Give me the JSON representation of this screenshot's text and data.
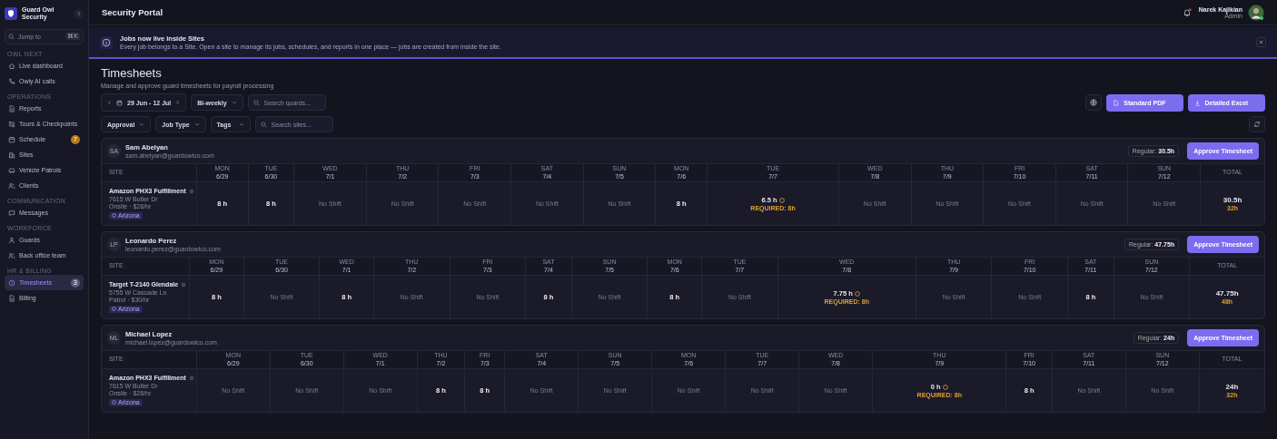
{
  "brand": {
    "name": "Guard Owl Security"
  },
  "sidebar": {
    "search": {
      "placeholder": "Jump to",
      "shortcut": "⌘K"
    },
    "sections": [
      {
        "title": "OWL NEXT",
        "items": [
          {
            "label": "Live dashboard",
            "selected": false
          },
          {
            "label": "Owly AI calls",
            "selected": false
          }
        ]
      },
      {
        "title": "OPERATIONS",
        "items": [
          {
            "label": "Reports",
            "selected": false
          },
          {
            "label": "Tours & Checkpoints",
            "selected": false
          },
          {
            "label": "Schedule",
            "selected": false,
            "badge": {
              "text": "7",
              "color": "#b7791f"
            }
          },
          {
            "label": "Sites",
            "selected": false
          },
          {
            "label": "Vehicle Patrols",
            "selected": false
          },
          {
            "label": "Clients",
            "selected": false
          }
        ]
      },
      {
        "title": "COMMUNICATION",
        "items": [
          {
            "label": "Messages",
            "selected": false
          }
        ]
      },
      {
        "title": "WORKFORCE",
        "items": [
          {
            "label": "Guards",
            "selected": false
          },
          {
            "label": "Back office team",
            "selected": false
          }
        ]
      },
      {
        "title": "HR & BILLING",
        "items": [
          {
            "label": "Timesheets",
            "selected": true,
            "badge": {
              "text": "3",
              "color": "#5a5a78"
            }
          },
          {
            "label": "Billing",
            "selected": false
          }
        ]
      }
    ]
  },
  "header": {
    "title": "Security Portal",
    "user": {
      "name": "Narek Kajikian",
      "role": "Admin"
    },
    "notifications_unread": true
  },
  "banner": {
    "title": "Jobs now live inside Sites",
    "text": "Every job belongs to a Site. Open a site to manage its jobs, schedules, and reports in one place — jobs are created from inside the site."
  },
  "page": {
    "title": "Timesheets",
    "subtitle": "Manage and approve guard timesheets for payroll processing"
  },
  "toolbar": {
    "date_range": "29 Jun - 12 Jul",
    "period": "Bi-weekly",
    "guard_search": {
      "placeholder": "Search guards..."
    },
    "export_buttons": [
      "Standard PDF",
      "Detailed Excel"
    ]
  },
  "filters": {
    "dropdowns": [
      "Approval",
      "Job Type",
      "Tags"
    ],
    "site_search": {
      "placeholder": "Search sites..."
    }
  },
  "timesheets": [
    {
      "site_column": "SITE",
      "total_column": "TOTAL",
      "initials": "SA",
      "name": "Sam Abelyan",
      "email": "sam.abelyan@guardowlco.com",
      "regular_label": "Regular:",
      "regular": "30.5h",
      "approve": "Approve Timesheet",
      "days": [
        {
          "day": "MON",
          "date": "6/29"
        },
        {
          "day": "TUE",
          "date": "6/30"
        },
        {
          "day": "WED",
          "date": "7/1"
        },
        {
          "day": "THU",
          "date": "7/2"
        },
        {
          "day": "FRI",
          "date": "7/3"
        },
        {
          "day": "SAT",
          "date": "7/4"
        },
        {
          "day": "SUN",
          "date": "7/5"
        },
        {
          "day": "MON",
          "date": "7/6"
        },
        {
          "day": "TUE",
          "date": "7/7"
        },
        {
          "day": "WED",
          "date": "7/8"
        },
        {
          "day": "THU",
          "date": "7/9"
        },
        {
          "day": "FRI",
          "date": "7/10"
        },
        {
          "day": "SAT",
          "date": "7/11"
        },
        {
          "day": "SUN",
          "date": "7/12"
        }
      ],
      "site": {
        "name": "Amazon PHX3 Fulfillment",
        "address": "7615 W Butler Dr",
        "rate": "Onsite · $28/hr",
        "tag": "Arizona"
      },
      "cells": [
        {
          "kind": "hours",
          "text": "8 h"
        },
        {
          "kind": "hours",
          "text": "8 h"
        },
        {
          "kind": "none",
          "text": "No Shift"
        },
        {
          "kind": "none",
          "text": "No Shift"
        },
        {
          "kind": "none",
          "text": "No Shift"
        },
        {
          "kind": "none",
          "text": "No Shift"
        },
        {
          "kind": "none",
          "text": "No Shift"
        },
        {
          "kind": "hours",
          "text": "8 h"
        },
        {
          "kind": "short",
          "text": "6.5 h",
          "note": "REQUIRED: 8h"
        },
        {
          "kind": "none",
          "text": "No Shift"
        },
        {
          "kind": "none",
          "text": "No Shift"
        },
        {
          "kind": "none",
          "text": "No Shift"
        },
        {
          "kind": "none",
          "text": "No Shift"
        },
        {
          "kind": "none",
          "text": "No Shift"
        }
      ],
      "total": "30.5h",
      "total_note": "32h"
    },
    {
      "site_column": "SITE",
      "total_column": "TOTAL",
      "initials": "LP",
      "name": "Leonardo Perez",
      "email": "leonardo.perez@guardowlco.com",
      "regular_label": "Regular:",
      "regular": "47.75h",
      "approve": "Approve Timesheet",
      "days": [
        {
          "day": "MON",
          "date": "6/29"
        },
        {
          "day": "TUE",
          "date": "6/30"
        },
        {
          "day": "WED",
          "date": "7/1"
        },
        {
          "day": "THU",
          "date": "7/2"
        },
        {
          "day": "FRI",
          "date": "7/3"
        },
        {
          "day": "SAT",
          "date": "7/4"
        },
        {
          "day": "SUN",
          "date": "7/5"
        },
        {
          "day": "MON",
          "date": "7/6"
        },
        {
          "day": "TUE",
          "date": "7/7"
        },
        {
          "day": "WED",
          "date": "7/8"
        },
        {
          "day": "THU",
          "date": "7/9"
        },
        {
          "day": "FRI",
          "date": "7/10"
        },
        {
          "day": "SAT",
          "date": "7/11"
        },
        {
          "day": "SUN",
          "date": "7/12"
        }
      ],
      "site": {
        "name": "Target T-2140 Glendale",
        "address": "5755 W Cascade Ln",
        "rate": "Patrol · $30/hr",
        "tag": "Arizona"
      },
      "cells": [
        {
          "kind": "hours",
          "text": "8 h"
        },
        {
          "kind": "none",
          "text": "No Shift"
        },
        {
          "kind": "hours",
          "text": "8 h"
        },
        {
          "kind": "none",
          "text": "No Shift"
        },
        {
          "kind": "none",
          "text": "No Shift"
        },
        {
          "kind": "hours",
          "text": "8 h"
        },
        {
          "kind": "none",
          "text": "No Shift"
        },
        {
          "kind": "hours",
          "text": "8 h"
        },
        {
          "kind": "none",
          "text": "No Shift"
        },
        {
          "kind": "short",
          "text": "7.75 h",
          "note": "REQUIRED: 8h"
        },
        {
          "kind": "none",
          "text": "No Shift"
        },
        {
          "kind": "none",
          "text": "No Shift"
        },
        {
          "kind": "hours",
          "text": "8 h"
        },
        {
          "kind": "none",
          "text": "No Shift"
        }
      ],
      "total": "47.75h",
      "total_note": "48h"
    },
    {
      "site_column": "SITE",
      "total_column": "TOTAL",
      "initials": "ML",
      "name": "Michael Lopez",
      "email": "michael.lopez@guardowlco.com",
      "regular_label": "Regular:",
      "regular": "24h",
      "approve": "Approve Timesheet",
      "days": [
        {
          "day": "MON",
          "date": "6/29"
        },
        {
          "day": "TUE",
          "date": "6/30"
        },
        {
          "day": "WED",
          "date": "7/1"
        },
        {
          "day": "THU",
          "date": "7/2"
        },
        {
          "day": "FRI",
          "date": "7/3"
        },
        {
          "day": "SAT",
          "date": "7/4"
        },
        {
          "day": "SUN",
          "date": "7/5"
        },
        {
          "day": "MON",
          "date": "7/6"
        },
        {
          "day": "TUE",
          "date": "7/7"
        },
        {
          "day": "WED",
          "date": "7/8"
        },
        {
          "day": "THU",
          "date": "7/9"
        },
        {
          "day": "FRI",
          "date": "7/10"
        },
        {
          "day": "SAT",
          "date": "7/11"
        },
        {
          "day": "SUN",
          "date": "7/12"
        }
      ],
      "site": {
        "name": "Amazon PHX3 Fulfillment",
        "address": "7615 W Butler Dr",
        "rate": "Onsite · $28/hr",
        "tag": "Arizona"
      },
      "cells": [
        {
          "kind": "none",
          "text": "No Shift"
        },
        {
          "kind": "none",
          "text": "No Shift"
        },
        {
          "kind": "none",
          "text": "No Shift"
        },
        {
          "kind": "hours",
          "text": "8 h"
        },
        {
          "kind": "hours",
          "text": "8 h"
        },
        {
          "kind": "none",
          "text": "No Shift"
        },
        {
          "kind": "none",
          "text": "No Shift"
        },
        {
          "kind": "none",
          "text": "No Shift"
        },
        {
          "kind": "none",
          "text": "No Shift"
        },
        {
          "kind": "none",
          "text": "No Shift"
        },
        {
          "kind": "short",
          "text": "0 h",
          "note": "REQUIRED: 8h"
        },
        {
          "kind": "hours",
          "text": "8 h"
        },
        {
          "kind": "none",
          "text": "No Shift"
        },
        {
          "kind": "none",
          "text": "No Shift"
        }
      ],
      "total": "24h",
      "total_note": "32h"
    }
  ]
}
